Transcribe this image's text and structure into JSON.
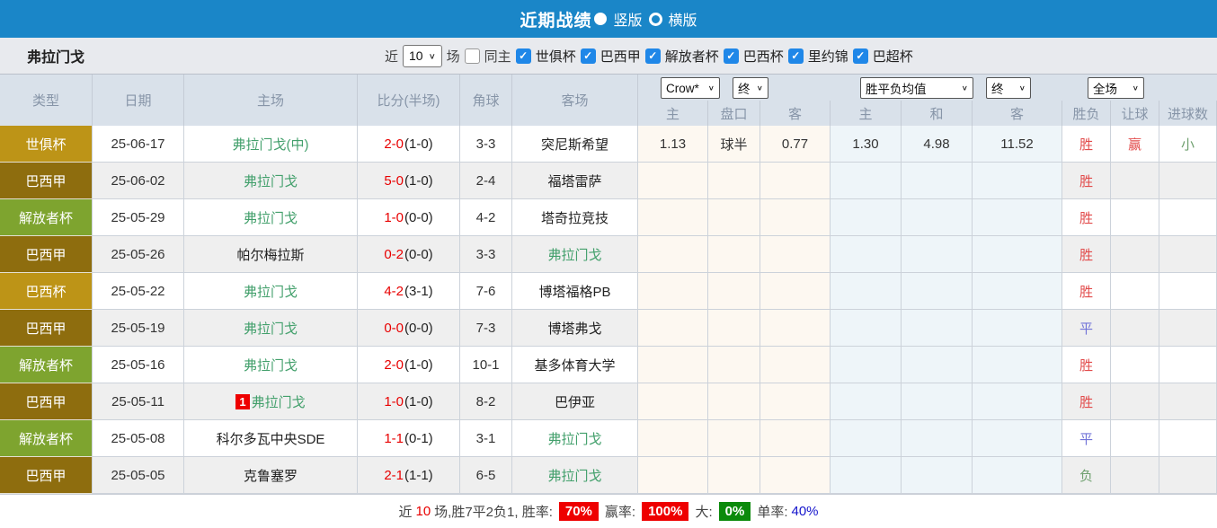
{
  "topbar": {
    "title": "近期战绩",
    "vertical_label": "竖版",
    "horizontal_label": "横版"
  },
  "filterbar": {
    "team": "弗拉门戈",
    "near": "近",
    "rounds": "10",
    "games": "场",
    "same_home": "同主",
    "checkmark": "✓",
    "leagues": [
      "世俱杯",
      "巴西甲",
      "解放者杯",
      "巴西杯",
      "里约锦",
      "巴超杯"
    ]
  },
  "header": {
    "type": "类型",
    "date": "日期",
    "home": "主场",
    "score": "比分(半场)",
    "corner": "角球",
    "away": "客场",
    "bookmaker_select": "Crow*",
    "final_a": "终",
    "avg_select": "胜平负均值",
    "final_b": "终",
    "scope_select": "全场",
    "sub": {
      "ah_home": "主",
      "ah_line": "盘口",
      "ah_away": "客",
      "eu_home": "主",
      "eu_draw": "和",
      "eu_away": "客",
      "result": "胜负",
      "handicap": "让球",
      "goals": "进球数"
    }
  },
  "rows": [
    {
      "league": "世俱杯",
      "date": "25-06-17",
      "home": "弗拉门戈(中)",
      "score": "2-0",
      "half": "(1-0)",
      "corner": "3-3",
      "away": "突尼斯希望",
      "ah_home": "1.13",
      "ah_line": "球半",
      "ah_away": "0.77",
      "eu_home": "1.30",
      "eu_draw": "4.98",
      "eu_away": "11.52",
      "result": "胜",
      "handicap_result": "赢",
      "goals_result": "小"
    },
    {
      "league": "巴西甲",
      "date": "25-06-02",
      "home": "弗拉门戈",
      "score": "5-0",
      "half": "(1-0)",
      "corner": "2-4",
      "away": "福塔雷萨",
      "result": "胜"
    },
    {
      "league": "解放者杯",
      "date": "25-05-29",
      "home": "弗拉门戈",
      "score": "1-0",
      "half": "(0-0)",
      "corner": "4-2",
      "away": "塔奇拉竞技",
      "result": "胜"
    },
    {
      "league": "巴西甲",
      "date": "25-05-26",
      "home": "帕尔梅拉斯",
      "score": "0-2",
      "half": "(0-0)",
      "corner": "3-3",
      "away": "弗拉门戈",
      "result": "胜"
    },
    {
      "league": "巴西杯",
      "date": "25-05-22",
      "home": "弗拉门戈",
      "score": "4-2",
      "half": "(3-1)",
      "corner": "7-6",
      "away": "博塔福格PB",
      "result": "胜"
    },
    {
      "league": "巴西甲",
      "date": "25-05-19",
      "home": "弗拉门戈",
      "score": "0-0",
      "half": "(0-0)",
      "corner": "7-3",
      "away": "博塔弗戈",
      "result": "平"
    },
    {
      "league": "解放者杯",
      "date": "25-05-16",
      "home": "弗拉门戈",
      "score": "2-0",
      "half": "(1-0)",
      "corner": "10-1",
      "away": "基多体育大学",
      "result": "胜"
    },
    {
      "league": "巴西甲",
      "date": "25-05-11",
      "home_badge": "1",
      "home": "弗拉门戈",
      "score": "1-0",
      "half": "(1-0)",
      "corner": "8-2",
      "away": "巴伊亚",
      "result": "胜"
    },
    {
      "league": "解放者杯",
      "date": "25-05-08",
      "home": "科尔多瓦中央SDE",
      "score": "1-1",
      "half": "(0-1)",
      "corner": "3-1",
      "away": "弗拉门戈",
      "result": "平"
    },
    {
      "league": "巴西甲",
      "date": "25-05-05",
      "home": "克鲁塞罗",
      "score": "2-1",
      "half": "(1-1)",
      "corner": "6-5",
      "away": "弗拉门戈",
      "result": "负"
    }
  ],
  "footer": {
    "near": "近",
    "count": "10",
    "summary": "场,胜7平2负1, 胜率:",
    "win_rate": "70%",
    "handicap_label": "赢率:",
    "handicap_rate": "100%",
    "big_label": "大:",
    "big_rate": "0%",
    "single_label": "单率:",
    "single_rate": "40%"
  },
  "colors": {
    "topbar_blue": "#1a86c8",
    "checkbox_blue": "#1f87e8",
    "badge_gold": "#bd9417",
    "badge_brown": "#8e6d0e",
    "badge_olive": "#7ea42f",
    "team_green": "#43a06c",
    "score_red": "#e80000",
    "win_red": "#e24b4b",
    "draw_blue": "#7173d8",
    "loss_green": "#6fa06f"
  }
}
